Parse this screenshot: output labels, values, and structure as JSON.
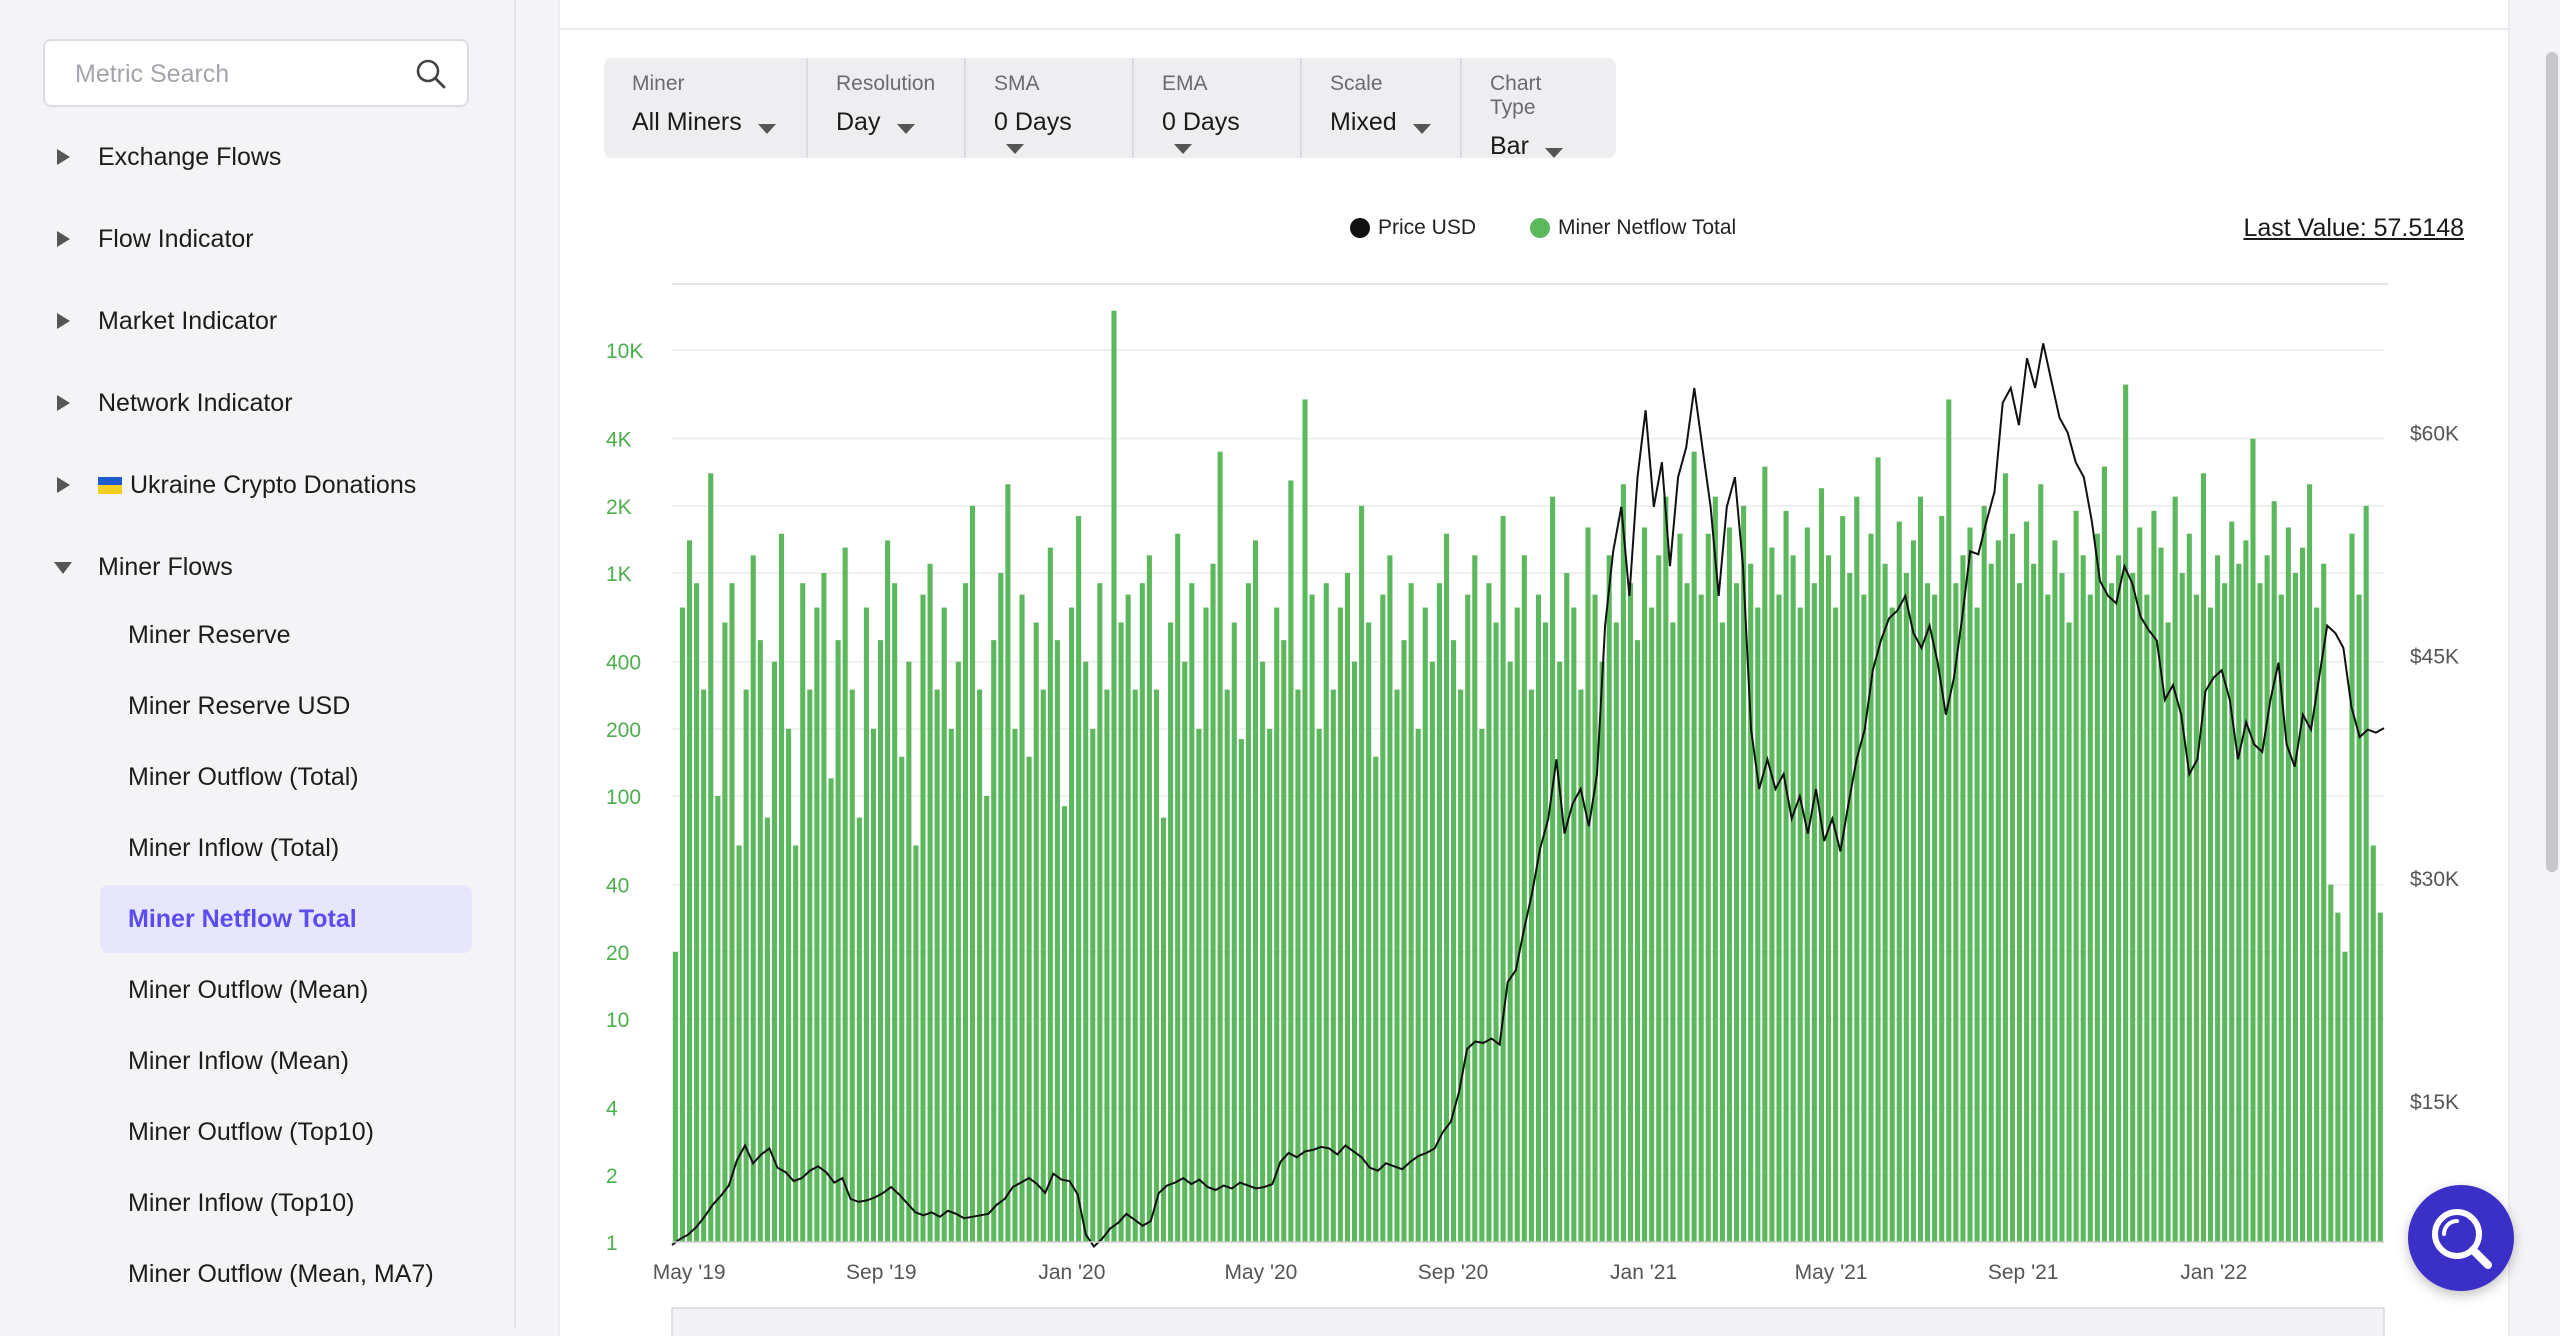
{
  "search": {
    "placeholder": "Metric Search"
  },
  "sidebar": {
    "groups": [
      {
        "label": "Exchange Flows",
        "expanded": false
      },
      {
        "label": "Flow Indicator",
        "expanded": false
      },
      {
        "label": "Market Indicator",
        "expanded": false
      },
      {
        "label": "Network Indicator",
        "expanded": false
      },
      {
        "label": "Ukraine Crypto Donations",
        "expanded": false
      },
      {
        "label": "Miner Flows",
        "expanded": true
      }
    ],
    "sub_items": [
      {
        "label": "Miner Reserve",
        "active": false
      },
      {
        "label": "Miner Reserve USD",
        "active": false
      },
      {
        "label": "Miner Outflow (Total)",
        "active": false
      },
      {
        "label": "Miner Inflow (Total)",
        "active": false
      },
      {
        "label": "Miner Netflow Total",
        "active": true
      },
      {
        "label": "Miner Outflow (Mean)",
        "active": false
      },
      {
        "label": "Miner Inflow (Mean)",
        "active": false
      },
      {
        "label": "Miner Outflow (Top10)",
        "active": false
      },
      {
        "label": "Miner Inflow (Top10)",
        "active": false
      },
      {
        "label": "Miner Outflow (Mean, MA7)",
        "active": false
      }
    ]
  },
  "toolbar": {
    "miner": {
      "label": "Miner",
      "value": "All Miners"
    },
    "resolution": {
      "label": "Resolution",
      "value": "Day"
    },
    "sma": {
      "label": "SMA",
      "value": "0 Days"
    },
    "ema": {
      "label": "EMA",
      "value": "0 Days"
    },
    "scale": {
      "label": "Scale",
      "value": "Mixed"
    },
    "chart_type": {
      "label": "Chart Type",
      "value": "Bar"
    }
  },
  "legend": {
    "price": {
      "label": "Price USD",
      "color": "#111111"
    },
    "netflow": {
      "label": "Miner Netflow Total",
      "color": "#5cb85c"
    }
  },
  "last_value": "Last Value: 57.5148",
  "chart_data": {
    "type": "bar",
    "x_range": [
      "2019-04-20",
      "2022-04-20"
    ],
    "x_tick_labels": [
      "May '19",
      "Sep '19",
      "Jan '20",
      "May '20",
      "Sep '20",
      "Jan '21",
      "May '21",
      "Sep '21",
      "Jan '22"
    ],
    "left_axis": {
      "scale": "log",
      "tick_labels": [
        "1",
        "2",
        "4",
        "10",
        "20",
        "40",
        "100",
        "200",
        "400",
        "1K",
        "2K",
        "4K",
        "10K"
      ],
      "ylim": [
        1,
        10000
      ],
      "color": "#4cae4c"
    },
    "right_axis": {
      "scale": "linear",
      "tick_labels": [
        "$15K",
        "$30K",
        "$45K",
        "$60K"
      ],
      "ylim": [
        5500,
        70000
      ],
      "color": "#555555"
    },
    "grid": true,
    "legend_position": "top-center",
    "series": [
      {
        "name": "Miner Netflow Total",
        "axis": "left",
        "color": "#5cb85c",
        "values": [
          20,
          700,
          1400,
          900,
          300,
          2800,
          100,
          600,
          900,
          60,
          300,
          1200,
          500,
          80,
          400,
          1500,
          200,
          60,
          900,
          300,
          700,
          1000,
          120,
          500,
          1300,
          300,
          80,
          700,
          200,
          500,
          1400,
          900,
          150,
          400,
          60,
          800,
          1100,
          300,
          700,
          200,
          400,
          900,
          2000,
          300,
          100,
          500,
          1000,
          2500,
          200,
          800,
          150,
          600,
          300,
          1300,
          500,
          90,
          700,
          1800,
          400,
          200,
          900,
          300,
          15000,
          600,
          800,
          300,
          900,
          1200,
          300,
          80,
          600,
          1500,
          400,
          900,
          200,
          700,
          1100,
          3500,
          300,
          600,
          180,
          900,
          1400,
          400,
          200,
          700,
          500,
          2600,
          300,
          6000,
          800,
          200,
          900,
          300,
          700,
          1000,
          400,
          2000,
          600,
          150,
          800,
          1200,
          300,
          500,
          900,
          200,
          700,
          400,
          900,
          1500,
          500,
          300,
          800,
          1200,
          200,
          900,
          600,
          1800,
          400,
          700,
          1200,
          300,
          800,
          600,
          2200,
          400,
          1000,
          700,
          300,
          1600,
          800,
          400,
          1200,
          600,
          2500,
          900,
          500,
          1600,
          700,
          1200,
          2200,
          600,
          1500,
          900,
          3500,
          800,
          1500,
          2200,
          600,
          1600,
          900,
          2000,
          1100,
          700,
          3000,
          1300,
          800,
          1900,
          1200,
          700,
          1600,
          900,
          2400,
          1200,
          700,
          1800,
          1000,
          2200,
          800,
          1500,
          3300,
          1100,
          700,
          1700,
          1000,
          1400,
          2200,
          900,
          800,
          1800,
          6000,
          900,
          1200,
          1600,
          700,
          2000,
          1100,
          1400,
          2800,
          1500,
          900,
          1700,
          1100,
          2500,
          800,
          1400,
          1000,
          600,
          1900,
          1200,
          800,
          1500,
          3000,
          900,
          1200,
          7000,
          1000,
          1600,
          800,
          1900,
          1300,
          600,
          2200,
          1000,
          1500,
          800,
          2800,
          700,
          1200,
          900,
          1700,
          1100,
          1400,
          4000,
          900,
          1200,
          2100,
          800,
          1600,
          1000,
          1300,
          2500,
          700,
          1100,
          40,
          30,
          20,
          1500,
          800,
          2000,
          60,
          30
        ]
      },
      {
        "name": "Price USD",
        "axis": "right",
        "color": "#111111",
        "values": [
          5300,
          5700,
          6000,
          6500,
          7200,
          8000,
          8600,
          9300,
          11000,
          12000,
          10800,
          11400,
          11800,
          10500,
          10200,
          9600,
          9800,
          10300,
          10600,
          10200,
          9500,
          9800,
          8400,
          8200,
          8300,
          8500,
          8800,
          9200,
          8700,
          8100,
          7500,
          7300,
          7500,
          7200,
          7600,
          7400,
          7100,
          7200,
          7300,
          7400,
          8000,
          8400,
          9200,
          9500,
          9800,
          9400,
          8800,
          10100,
          9700,
          9600,
          8700,
          6000,
          5200,
          5700,
          6400,
          6800,
          7400,
          7000,
          6600,
          6900,
          8800,
          9300,
          9500,
          9800,
          9400,
          9700,
          9200,
          9000,
          9300,
          9100,
          9500,
          9300,
          9100,
          9200,
          9400,
          10900,
          11500,
          11200,
          11600,
          11700,
          11900,
          11800,
          11400,
          12000,
          11600,
          11200,
          10500,
          10300,
          10800,
          10600,
          10400,
          10900,
          11300,
          11500,
          11800,
          12900,
          13600,
          15600,
          18500,
          19000,
          18900,
          19200,
          18800,
          23000,
          23800,
          26500,
          29000,
          32000,
          34000,
          38000,
          33000,
          35000,
          36000,
          33500,
          37000,
          47000,
          52000,
          55000,
          49000,
          57000,
          61500,
          55000,
          58000,
          51000,
          57000,
          59000,
          63000,
          59000,
          55000,
          49000,
          55000,
          57000,
          51000,
          40000,
          36000,
          38000,
          36000,
          37000,
          34000,
          35500,
          33000,
          36000,
          32500,
          34000,
          31800,
          35000,
          38000,
          40000,
          44000,
          46000,
          47500,
          48000,
          49000,
          46500,
          45500,
          47000,
          44500,
          41000,
          43500,
          47500,
          52000,
          51800,
          54000,
          56000,
          62000,
          63000,
          60500,
          65000,
          63000,
          66000,
          63500,
          61000,
          60000,
          58000,
          57000,
          54000,
          50000,
          49000,
          48500,
          51000,
          49800,
          47600,
          46700,
          46000,
          42000,
          43000,
          41000,
          37000,
          38000,
          42600,
          43500,
          44000,
          42000,
          38000,
          40500,
          39000,
          38500,
          42000,
          44500,
          39000,
          37500,
          41000,
          40000,
          43500,
          47000,
          46500,
          45500,
          41500,
          39500,
          40000,
          39800,
          40100
        ]
      }
    ]
  }
}
